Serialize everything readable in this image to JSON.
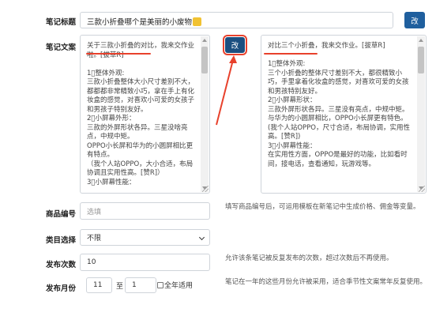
{
  "form": {
    "title": {
      "label": "笔记标题",
      "value": "三款小折叠哪个是美丽的小废物",
      "button": "改"
    },
    "copy": {
      "label": "笔记文案",
      "left_text": "关于三款小折叠的对比，我来交作业啦。[拔草R]\n\n1⃣整体外观:\n三款小折叠整体大小尺寸差别不大，都都都非常精致小巧，拿在手上有化妆盒的感觉，对喜欢小可爱的女孩子和男孩子特别友好。\n2⃣小屏幕外形：\n三款的外屏形状各异。三星没啥亮点，中规中矩。\nOPPO小长屏和华为的小圆屏相比更有特点。\n（我个人站OPPO，大小合适，布局协调且实用性高。[赞R]）\n3⃣小屏幕性能：",
      "button": "改",
      "right_text": "对比三个小折叠，我来交作业。[拔草R]\n\n1⃣整体外观:\n三个小折叠的整体尺寸差别不大，都很精致小巧，手里拿着化妆盒的感觉，对喜欢可爱的女孩和男孩特别友好。\n2⃣小屏幕形状：\n三款外屏形状各异。三星没有亮点，中规中矩。\n与华为的小圆屏相比，OPPO小长屏更有特色。\n(我个人站OPPO，尺寸合适，布局协调，实用性高。[赞R])\n3⃣小屏幕性能：\n在实用性方面，OPPO是最好的功能，比如看时间，接电话，查看通知，玩游戏等。"
    },
    "product": {
      "label": "商品编号",
      "placeholder": "选填",
      "hint": "填写商品编号后，可运用模板在新笔记中生成价格、佣金等变量。"
    },
    "category": {
      "label": "类目选择",
      "selected": "不限"
    },
    "publish_count": {
      "label": "发布次数",
      "value": "10",
      "hint": "允许该条笔记被反复发布的次数，超过次数后不再使用。"
    },
    "publish_month": {
      "label": "发布月份",
      "from": "11",
      "separator": "至",
      "to": "1",
      "all_year": "全年适用",
      "hint": "笔记在一年的这些月份允许被采用，适合季节性文案常年反复使用。"
    }
  },
  "colors": {
    "button": "#1f5f9e",
    "annotation": "#e8412c"
  }
}
